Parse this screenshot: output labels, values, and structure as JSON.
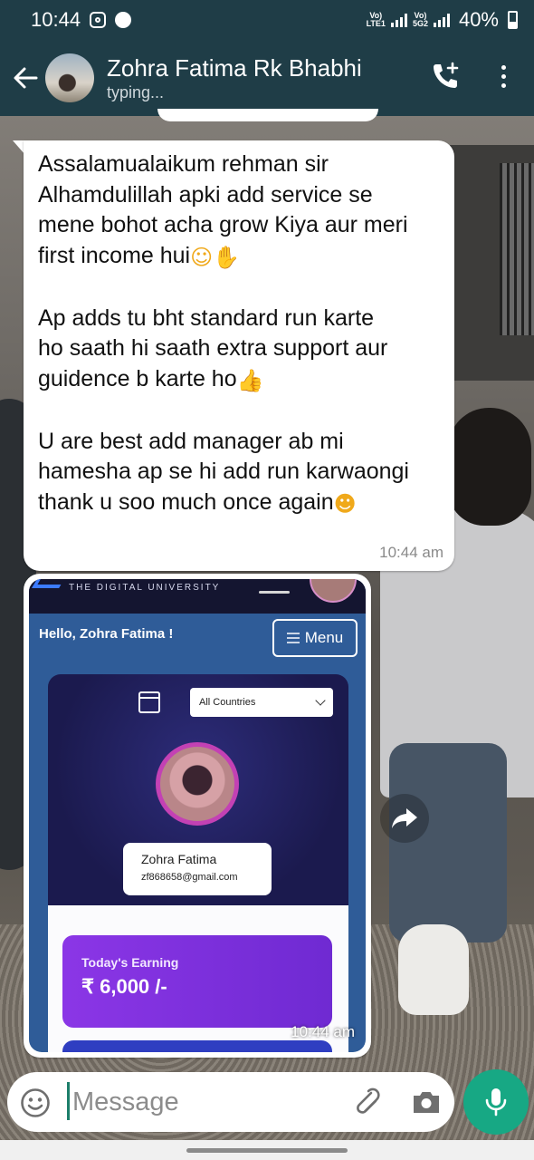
{
  "status_bar": {
    "time": "10:44",
    "network_1": "Vo) R LTE1",
    "network_2": "Vo) 5G LTE2",
    "battery": "40%"
  },
  "header": {
    "contact_name": "Zohra Fatima Rk Bhabhi",
    "contact_status": "typing..."
  },
  "messages": [
    {
      "text_lines": [
        "Assalamualaikum rehman sir",
        "Alhamdulillah apki add service se",
        "mene bohot acha grow Kiya aur meri",
        "first income hui",
        "",
        "Ap adds tu bht standard run karte",
        "ho saath hi saath extra support aur",
        "guidence b karte ho",
        "",
        "U are best add manager ab mi",
        "hamesha ap se hi add run karwaongi",
        "thank u soo much once again"
      ],
      "time": "10:44 am"
    },
    {
      "image": {
        "brand": "THE DIGITAL UNIVERSITY",
        "greeting": "Hello, Zohra Fatima !",
        "menu_label": "Menu",
        "country_select": "All Countries",
        "profile_name": "Zohra Fatima",
        "profile_email": "zf868658@gmail.com",
        "earning_label": "Today's Earning",
        "earning_value": "₹ 6,000 /-"
      },
      "time": "10:44 am"
    }
  ],
  "composer": {
    "placeholder": "Message"
  },
  "colors": {
    "header_bg": "#1f3d47",
    "mic_button": "#17a884",
    "bubble_bg": "#ffffff"
  }
}
